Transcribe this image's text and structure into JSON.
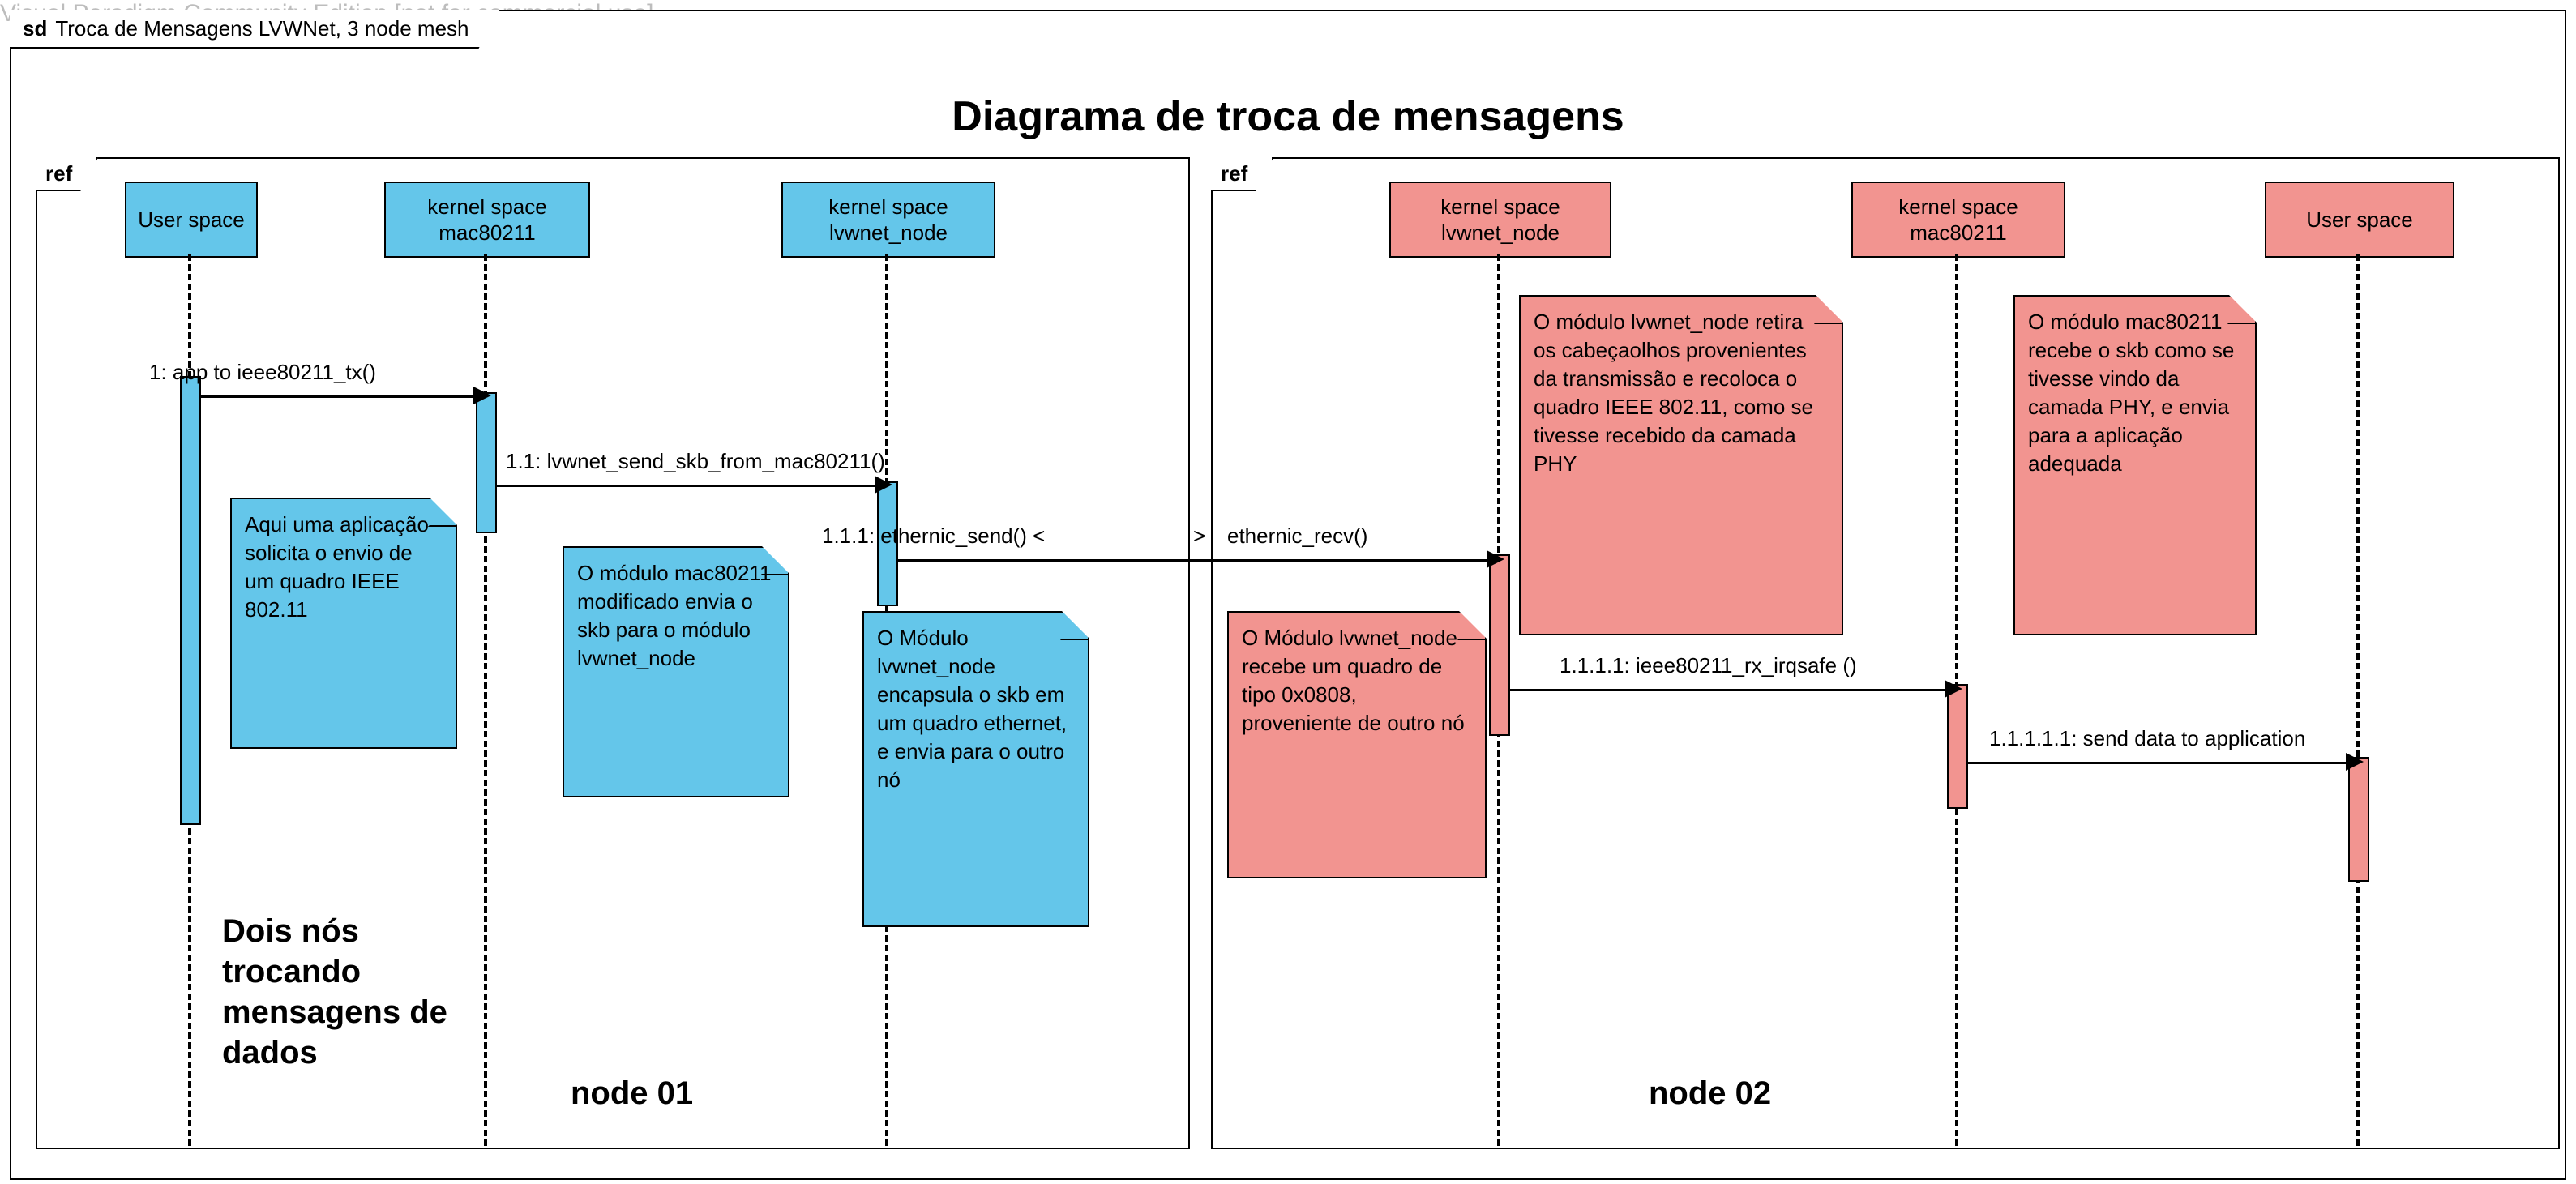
{
  "watermark": "Visual Paradigm Community Edition [not for commercial use]",
  "sd_prefix": "sd",
  "sd_title": "Troca de Mensagens LVWNet, 3 node mesh",
  "main_title": "Diagrama de troca de mensagens",
  "ref_label": "ref",
  "lifelines": {
    "l_user": "User space",
    "l_mac": "kernel space mac80211",
    "l_node": "kernel space lvwnet_node",
    "r_node": "kernel space lvwnet_node",
    "r_mac": "kernel space mac80211",
    "r_user": "User space"
  },
  "messages": {
    "m1": "1: app to ieee80211_tx()",
    "m11": "1.1: lvwnet_send_skb_from_mac80211()",
    "m111_left": "1.1.1: ethernic_send()  <",
    "m111_mid": ">",
    "m111_right": "ethernic_recv()",
    "m1111": "1.1.1.1: ieee80211_rx_irqsafe ()",
    "m11111": "1.1.1.1.1: send data to application"
  },
  "notes": {
    "n1": "Aqui uma aplicação solicita o envio de um quadro IEEE 802.11",
    "n2": "O módulo mac80211 modificado envia o skb para o módulo lvwnet_node",
    "n3": "O Módulo lvwnet_node  encapsula o skb em um quadro ethernet, e envia para o outro nó",
    "n4": "O Módulo lvwnet_node recebe um quadro de tipo 0x0808, proveniente de outro nó",
    "n5": "O módulo lvwnet_node retira os cabeçaolhos provenientes da transmissão e recoloca o quadro IEEE 802.11, como se tivesse recebido da camada PHY",
    "n6": "O módulo mac80211 recebe o skb como se tivesse vindo da camada PHY, e envia para a aplicação adequada"
  },
  "big_labels": {
    "twos": "Dois nós trocando mensagens de dados",
    "node1": "node 01",
    "node2": "node 02"
  }
}
